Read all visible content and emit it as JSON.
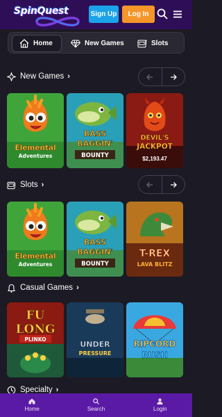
{
  "header": {
    "logo_text": "SpinQuest",
    "signup_label": "Sign Up",
    "login_label": "Log In"
  },
  "tabs": [
    {
      "label": "Home",
      "icon": "home-icon",
      "active": true
    },
    {
      "label": "New Games",
      "icon": "diamond-icon",
      "active": false
    },
    {
      "label": "Slots",
      "icon": "slot-machine-icon",
      "active": false
    }
  ],
  "sections": {
    "new_games": {
      "title": "New Games",
      "icon": "sparkle-icon",
      "games": [
        {
          "title": "Elemental Adventures"
        },
        {
          "title": "Bass Baggin' Bounty"
        },
        {
          "title": "Devil's Jackpot",
          "jackpot": "$2,193.47"
        }
      ]
    },
    "slots": {
      "title": "Slots",
      "icon": "slot-machine-icon",
      "games": [
        {
          "title": "Elemental Adventures"
        },
        {
          "title": "Bass Baggin' Bounty"
        },
        {
          "title": "T-Rex Lava Blitz"
        }
      ]
    },
    "casual": {
      "title": "Casual Games",
      "icon": "bell-icon",
      "games": [
        {
          "title": "Fu Long Plinko"
        },
        {
          "title": "Under Pressure"
        },
        {
          "title": "Ripcord Rush"
        }
      ]
    },
    "specialty": {
      "title": "Specialty",
      "icon": "specialty-icon"
    }
  },
  "tile_text": {
    "elemental_1": "Elemental",
    "elemental_2": "Adventures",
    "bass_1": "BASS",
    "bass_2": "BAGGIN'",
    "bass_3": "BOUNTY",
    "devil_1": "DEVIL'S",
    "devil_2": "JACKPOT",
    "devil_amount": "$2,193.47",
    "trex_1": "T-REX",
    "trex_2": "LAVA BLITZ",
    "fulong_1": "FU",
    "fulong_2": "LONG",
    "fulong_3": "PLINKO",
    "under_1": "UNDER",
    "under_2": "PRESSURE",
    "ripcord_1": "RIPCORD",
    "ripcord_2": "RUSH"
  },
  "bottom_nav": [
    {
      "label": "Home",
      "icon": "home-icon"
    },
    {
      "label": "Search",
      "icon": "search-icon"
    },
    {
      "label": "Login",
      "icon": "user-icon"
    }
  ],
  "colors": {
    "header_bg": "#2e0f57",
    "page_bg": "#1c1a24",
    "signup": "#1aa3e8",
    "login": "#f5962a",
    "bottom_nav_bg": "#5b1aa6"
  }
}
